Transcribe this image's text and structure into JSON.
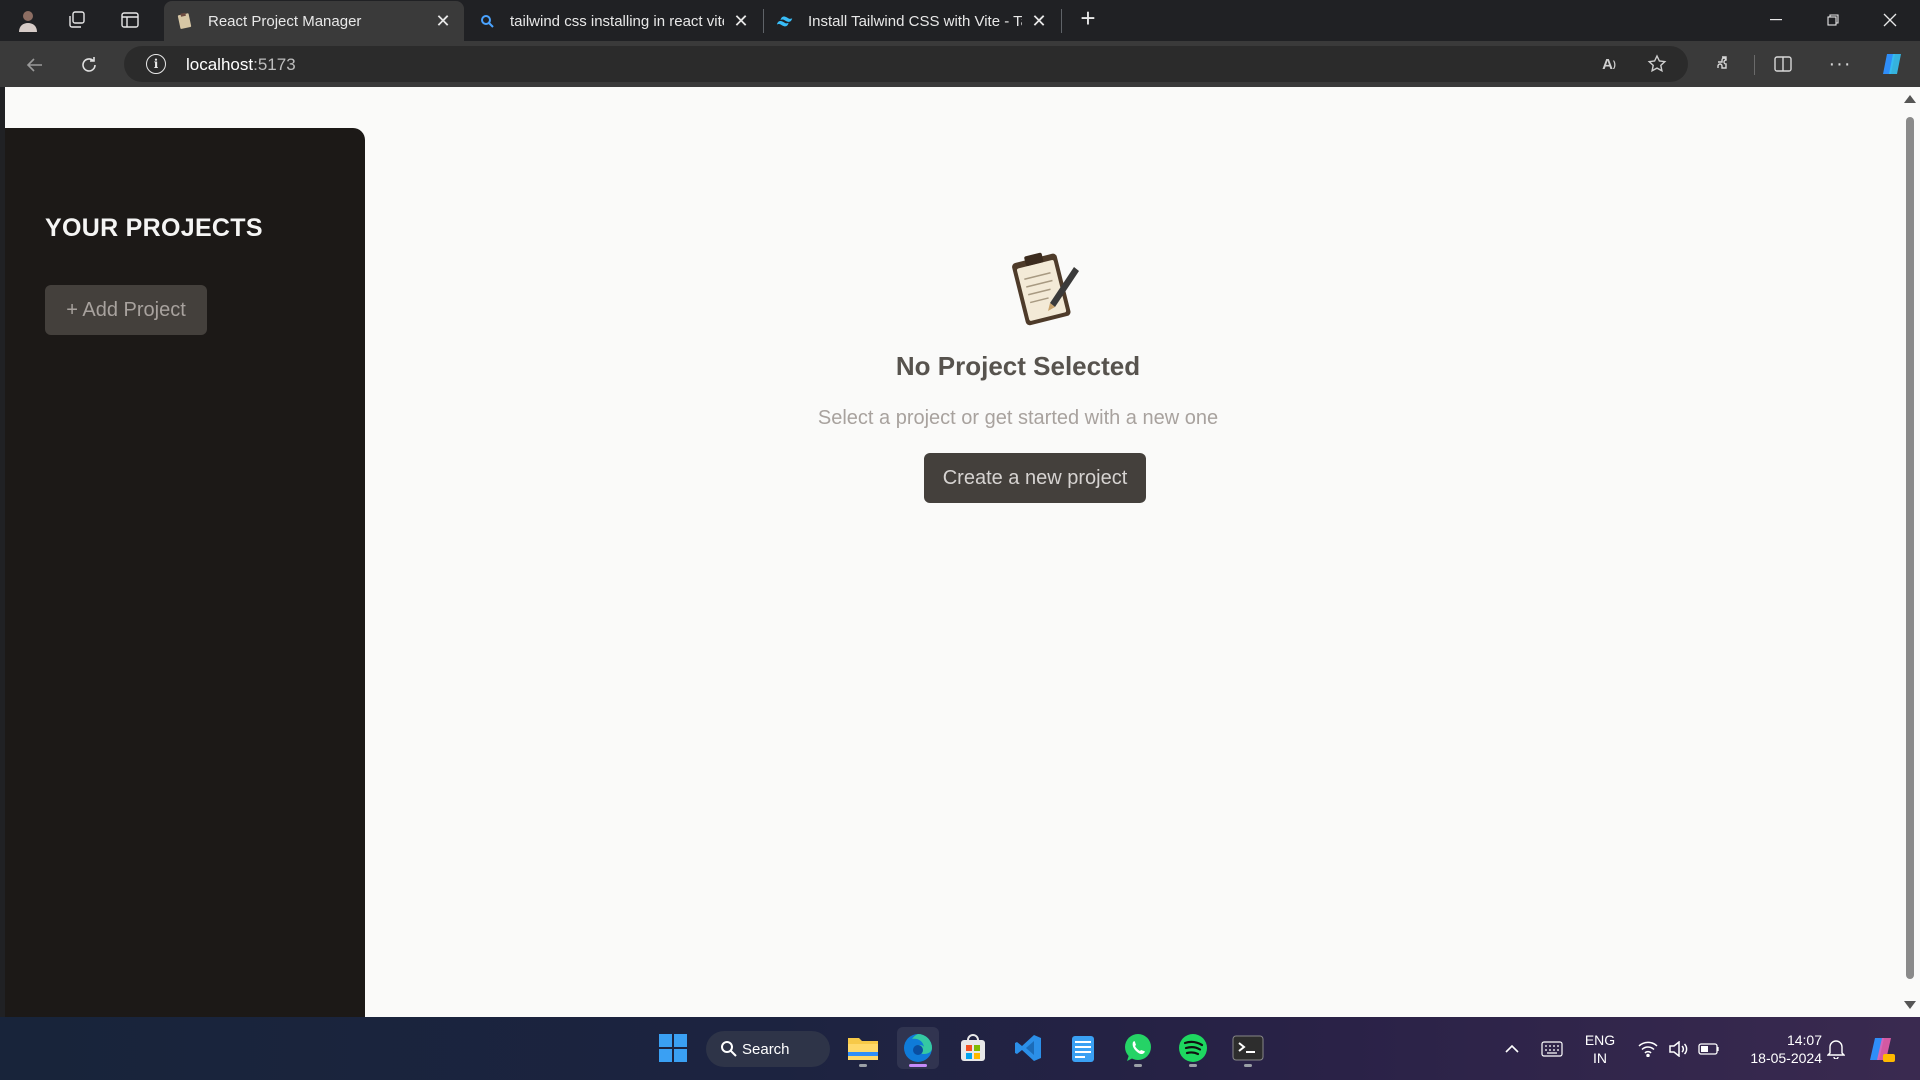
{
  "browser": {
    "tabs": [
      {
        "title": "React Project Manager",
        "active": true
      },
      {
        "title": "tailwind css installing in react vite",
        "active": false
      },
      {
        "title": "Install Tailwind CSS with Vite - Tailwind",
        "active": false
      }
    ],
    "url_host": "localhost",
    "url_port": ":5173"
  },
  "sidebar": {
    "title": "YOUR PROJECTS",
    "add_button": "+ Add Project"
  },
  "main": {
    "heading": "No Project Selected",
    "subtitle": "Select a project or get started with a new one",
    "create_button": "Create a new project"
  },
  "taskbar": {
    "search_label": "Search",
    "language_top": "ENG",
    "language_bottom": "IN",
    "time": "14:07",
    "date": "18-05-2024"
  },
  "colors": {
    "sidebar_bg": "#1c1917",
    "button_bg": "#44403c",
    "page_bg": "#fafaf9"
  }
}
